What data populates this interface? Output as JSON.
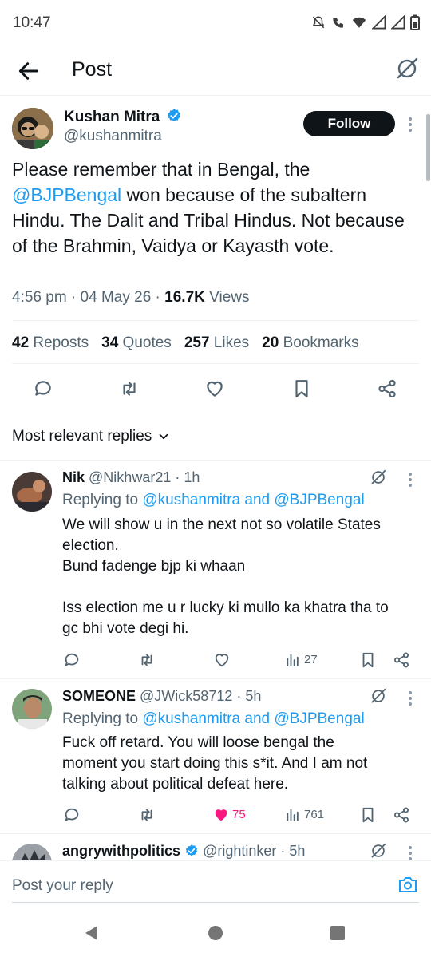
{
  "status_bar": {
    "time": "10:47"
  },
  "header": {
    "title": "Post",
    "back_icon": "arrow-left-icon",
    "grok_icon": "grok-icon"
  },
  "post": {
    "author_name": "Kushan Mitra",
    "author_handle": "@kushanmitra",
    "verified": true,
    "follow_label": "Follow",
    "text_part1": "Please remember that in Bengal, the ",
    "mention": "@BJPBengal",
    "text_part2": " won because of the subaltern Hindu. The Dalit and Tribal Hindus. Not because of the Brahmin, Vaidya or Kayasth vote.",
    "time": "4:56 pm",
    "date": "04 May 26",
    "views_count": "16.7K",
    "views_label": "Views",
    "stats": {
      "reposts_count": "42",
      "reposts_label": "Reposts",
      "quotes_count": "34",
      "quotes_label": "Quotes",
      "likes_count": "257",
      "likes_label": "Likes",
      "bookmarks_count": "20",
      "bookmarks_label": "Bookmarks"
    }
  },
  "replies_sort_label": "Most relevant replies",
  "replies": [
    {
      "name": "Nik",
      "handle": "@Nikhwar21",
      "time": "1h",
      "replying_prefix": "Replying to ",
      "replying_to": "@kushanmitra and @BJPBengal",
      "line1": "We will show u in the next not so volatile States",
      "line2": "election.",
      "line3": "Bund fadenge bjp ki whaan",
      "line4": "Iss election me u r lucky ki mullo ka khatra tha to",
      "line5": "gc bhi vote degi hi.",
      "likes": "",
      "views": "27"
    },
    {
      "name": "SOMEONE",
      "handle": "@JWick58712",
      "time": "5h",
      "replying_prefix": "Replying to ",
      "replying_to": "@kushanmitra and @BJPBengal",
      "line1": "Fuck off retard. You will loose bengal the",
      "line2": "moment you start doing this s*it. And I am not",
      "line3": "talking about political defeat here.",
      "likes": "75",
      "views": "761"
    },
    {
      "name": "angrywithpolitics",
      "handle": "@rightinker",
      "time": "5h"
    }
  ],
  "compose": {
    "placeholder": "Post your reply"
  },
  "colors": {
    "accent": "#1d9bf0",
    "like_active": "#f91880",
    "text": "#0f1419",
    "muted": "#536471"
  }
}
